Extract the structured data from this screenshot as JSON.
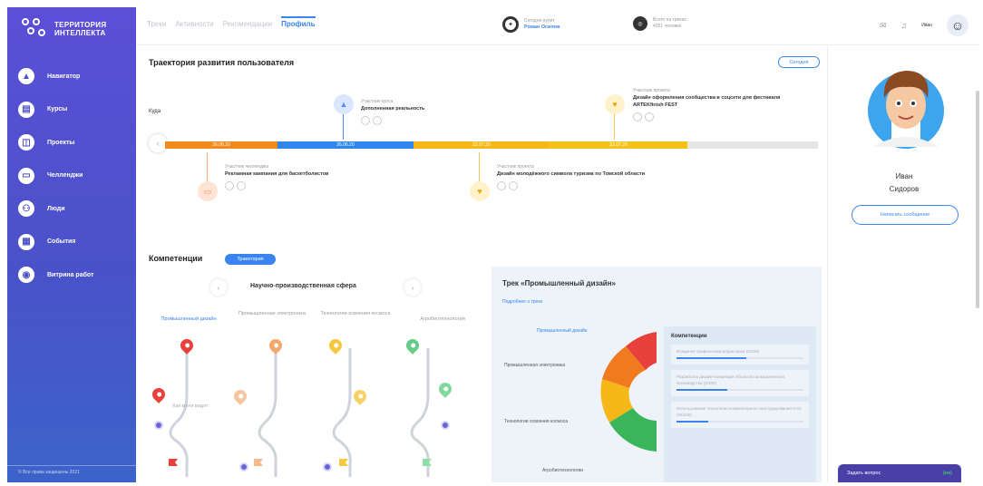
{
  "sidebar": {
    "logo_text": "ТЕРРИТОРИЯ ИНТЕЛЛЕКТА",
    "items": [
      {
        "label": "Навигатор",
        "icon": "navigator-arrow-icon"
      },
      {
        "label": "Курсы",
        "icon": "courses-icon"
      },
      {
        "label": "Проекты",
        "icon": "projects-icon"
      },
      {
        "label": "Челленджи",
        "icon": "challenges-icon"
      },
      {
        "label": "Люди",
        "icon": "people-icon"
      },
      {
        "label": "События",
        "icon": "events-icon"
      },
      {
        "label": "Витрина работ",
        "icon": "showcase-icon"
      }
    ],
    "footer": "© Все права защищены 2021"
  },
  "header": {
    "tabs": [
      {
        "label": "Треки",
        "active": false
      },
      {
        "label": "Активности",
        "active": false
      },
      {
        "label": "Рекомендации",
        "active": false
      },
      {
        "label": "Профиль",
        "active": true
      }
    ],
    "pilot": {
      "caption": "Сегодня рулит",
      "name": "Роман Осипов"
    },
    "tracks": {
      "caption": "Всего на треках",
      "count": "4051 человек"
    },
    "user_name": "Иван"
  },
  "trajectory": {
    "title": "Траектория развития пользователя",
    "today_button": "Сегодня",
    "kuda_label": "Куда",
    "bars": [
      {
        "label": "26.06.20",
        "color": "#f08a1c"
      },
      {
        "label": "26.06.20",
        "color": "#2f86ec"
      },
      {
        "label": "22.07.20",
        "color": "#f6b818"
      },
      {
        "label": "22.07.20",
        "color": "#f6c21a"
      },
      {
        "label": "",
        "color": "#e6e6e6"
      }
    ],
    "events": [
      {
        "caption": "Участник курса",
        "title": "Дополненная реальность",
        "color": "#5a8cf0"
      },
      {
        "caption": "Участник проекта",
        "title": "Дизайн оформления сообщества в соцсети для фестиваля ARTEKfinish FEST",
        "color": "#f3c24a"
      },
      {
        "caption": "Участник челленджа",
        "title": "Рекламная кампания для баскетболистов",
        "color": "#f6b086"
      },
      {
        "caption": "Участник проекта",
        "title": "Дизайн молодёжного символа туризма по Томской области",
        "color": "#f3c24a"
      }
    ]
  },
  "competencies": {
    "title": "Компетенции",
    "badge": "Траектория",
    "sphere": "Научно-производственная сфера",
    "columns": [
      {
        "label": "Промышленный дизайн",
        "active": true,
        "color": "#e8403a"
      },
      {
        "label": "Промышленная электроника",
        "active": false,
        "color": "#f5a66a"
      },
      {
        "label": "Технологии освоения космоса",
        "active": false,
        "color": "#f5c840"
      },
      {
        "label": "Агробиотехнологии",
        "active": false,
        "color": "#66cc88"
      }
    ],
    "path_label": "Как меня видят"
  },
  "track_panel": {
    "title": "Трек «Промышленный дизайн»",
    "link": "Подробнее о треке",
    "labels": [
      {
        "text": "Промышленный дизайн",
        "blue": true
      },
      {
        "text": "Промышленная электроника",
        "blue": false
      },
      {
        "text": "Технологии освоения космоса",
        "blue": false
      },
      {
        "text": "Агробиотехнологии",
        "blue": false
      }
    ],
    "donut_colors": [
      "#e8403a",
      "#f07a1e",
      "#f6b818",
      "#3ab55a"
    ],
    "comp_title": "Компетенции",
    "comp_items": [
      {
        "text": "Владение графическим редактором (5/100)",
        "progress": 0.55
      },
      {
        "text": "Разработка дизайн-концепции объектов промышленного производства (2/100)",
        "progress": 0.4
      },
      {
        "text": "Использование технологии компьютерного конструирования CAD (25/100)",
        "progress": 0.25
      }
    ]
  },
  "profile": {
    "first_name": "Иван",
    "last_name": "Сидоров",
    "message_button": "Написать сообщение",
    "ask_button": "Задать вопрос",
    "ask_status": "(не)"
  }
}
